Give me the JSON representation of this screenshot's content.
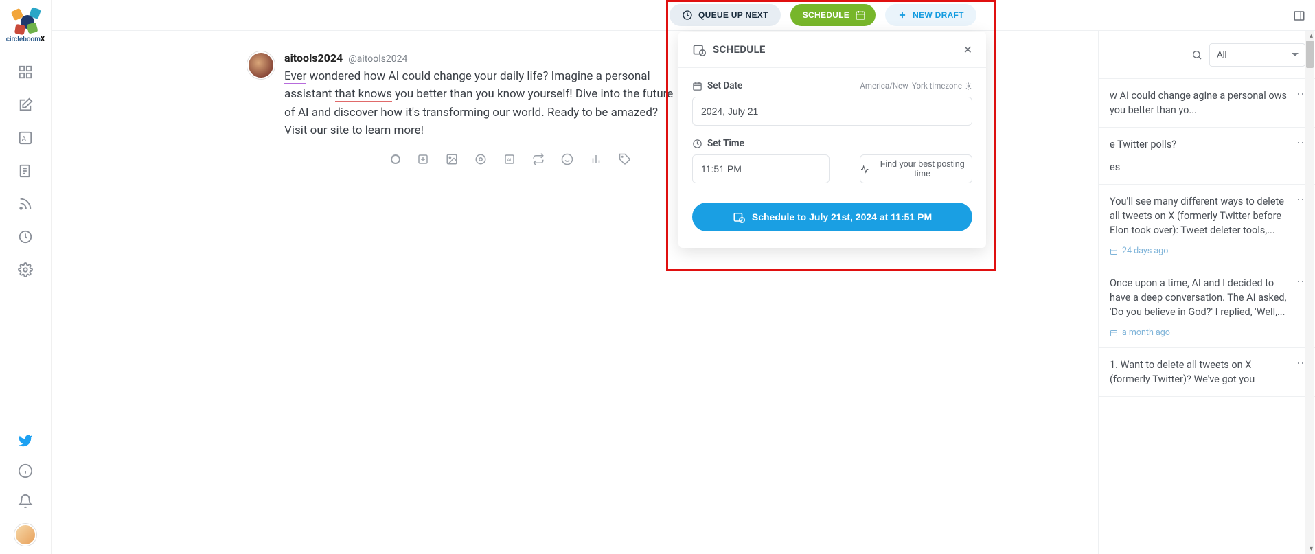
{
  "brand": {
    "name": "circleboom",
    "suffix": "X"
  },
  "topActions": {
    "queue": "QUEUE UP NEXT",
    "schedule": "SCHEDULE",
    "newDraft": "NEW DRAFT"
  },
  "compose": {
    "displayName": "aitools2024",
    "handle": "@aitools2024",
    "part1a": "Ever",
    "part1b": " wondered how AI could change your daily life? Imagine a personal assistant ",
    "part2a": "that knows",
    "part2b": " you better than you know yourself! Dive into the future of AI and discover how it's transforming our world. Ready to be amazed? Visit our site to learn more!"
  },
  "schedulePanel": {
    "title": "SCHEDULE",
    "setDateLabel": "Set Date",
    "timezone": "America/New_York timezone",
    "dateValue": "2024, July 21",
    "setTimeLabel": "Set Time",
    "timeValue": "11:51 PM",
    "bestTime": "Find your best posting time",
    "submit": "Schedule to July 21st, 2024 at 11:51 PM"
  },
  "rightCol": {
    "filter": "All",
    "drafts": [
      {
        "text": "w AI could change agine a personal ows you better than yo...",
        "date": ""
      },
      {
        "text": "e Twitter polls?",
        "date": "",
        "sub": "es"
      },
      {
        "text": "You'll see many different ways to delete all tweets on X (formerly Twitter before Elon took over): Tweet deleter tools,...",
        "date": "24 days ago"
      },
      {
        "text": "Once upon a time, AI and I decided to have a deep conversation. The AI asked, 'Do you believe in God?' I replied, 'Well,...",
        "date": "a month ago"
      },
      {
        "text": "1. Want to delete all tweets on X (formerly Twitter)? We've got you",
        "date": ""
      }
    ]
  }
}
